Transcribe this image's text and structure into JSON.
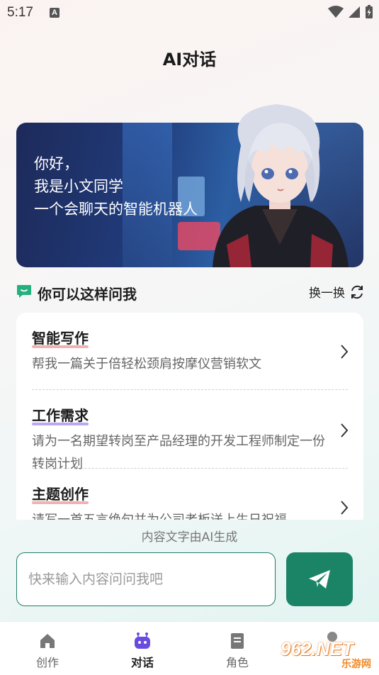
{
  "status_bar": {
    "time": "5:17",
    "notification_icon": "A"
  },
  "page_title": "AI对话",
  "banner": {
    "lines": [
      "你好，",
      "我是小文同学",
      "一个会聊天的智能机器人"
    ]
  },
  "suggestions": {
    "title": "你可以这样问我",
    "refresh_label": "换一换",
    "items": [
      {
        "title": "智能写作",
        "desc": "帮我一篇关于倍轻松颈肩按摩仪营销软文",
        "underline_color": "#f3b1b1"
      },
      {
        "title": "工作需求",
        "desc": "请为一名期望转岗至产品经理的开发工程师制定一份转岗计划",
        "underline_color": "#b9a9f2"
      },
      {
        "title": "主题创作",
        "desc": "请写一首五言绝句并为公司老板送上生日祝福",
        "underline_color": "#f3b1b1"
      }
    ]
  },
  "ai_note": "内容文字由AI生成",
  "input": {
    "placeholder": "快来输入内容问问我吧",
    "value": ""
  },
  "nav": {
    "items": [
      {
        "label": "创作",
        "icon": "home-icon"
      },
      {
        "label": "对话",
        "icon": "robot-icon",
        "active": true
      },
      {
        "label": "角色",
        "icon": "document-icon"
      }
    ]
  },
  "watermark": {
    "brand": "962.NET",
    "sub": "乐游网"
  },
  "colors": {
    "accent": "#1c8466",
    "chat_icon": "#23b07d"
  }
}
